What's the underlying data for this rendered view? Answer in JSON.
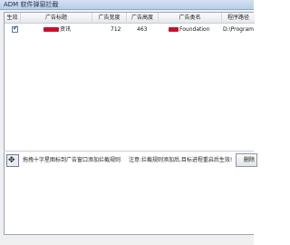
{
  "window": {
    "title": "ADM 软件弹窗拦截"
  },
  "table": {
    "headers": [
      "生效",
      "广告标题",
      "广告宽度",
      "广告高度",
      "广告类名",
      "程序路径"
    ],
    "rows": [
      {
        "enabled": true,
        "title": "资讯",
        "width": "712",
        "height": "463",
        "class_name": "Foundation",
        "path": "D:\\Program Files"
      }
    ]
  },
  "bottom": {
    "target_icon": "crosshair-icon",
    "tip_left": "拖拽十字星图标到广告窗口添加拦截规则",
    "tip_right": "注意:拦截规则添加后,目标进程重启后生效!",
    "delete_label": "删除"
  },
  "colors": {
    "accent_red": "#c8102e",
    "title_bar": "#b8cde8"
  }
}
